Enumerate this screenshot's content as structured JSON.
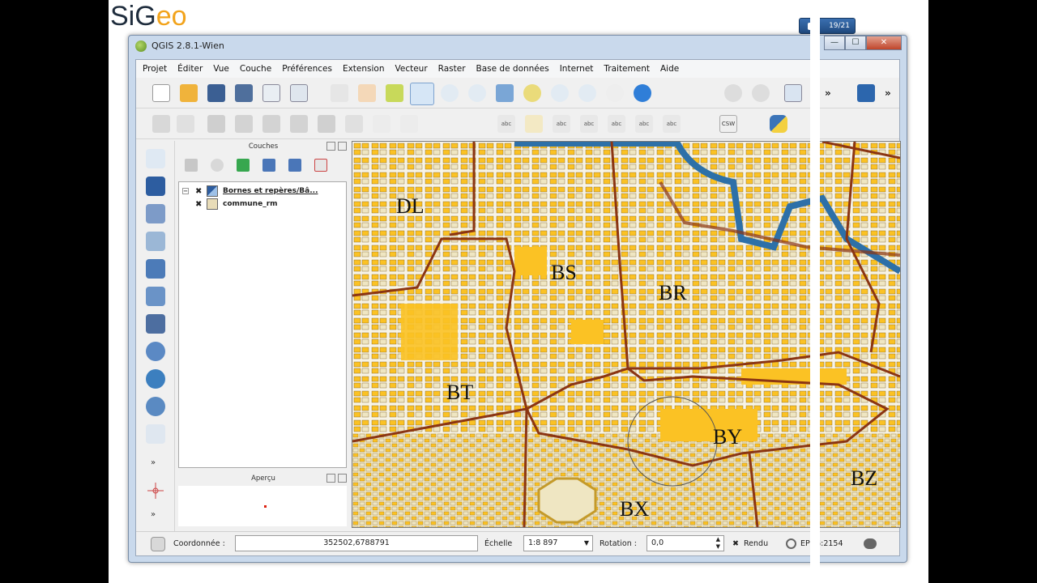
{
  "branding": {
    "logo_main": "SiG",
    "logo_accent": "eo"
  },
  "taskbar_badge": {
    "label": "19/21"
  },
  "window": {
    "title": "QGIS 2.8.1-Wien",
    "controls": {
      "minimize": "—",
      "maximize": "☐",
      "close": "✕"
    }
  },
  "menu": [
    "Projet",
    "Éditer",
    "Vue",
    "Couche",
    "Préférences",
    "Extension",
    "Vecteur",
    "Raster",
    "Base de données",
    "Internet",
    "Traitement",
    "Aide"
  ],
  "toolbar_overflow": "»",
  "layers_panel": {
    "title": "Couches",
    "layers": [
      {
        "name": "Bornes et repères/Bâ...",
        "checked": "✖",
        "expander": "−"
      },
      {
        "name": "commune_rm",
        "checked": "✖"
      }
    ]
  },
  "overview_panel": {
    "title": "Aperçu"
  },
  "map": {
    "labels": [
      "DL",
      "BS",
      "BR",
      "BT",
      "BY",
      "BZ",
      "BX"
    ],
    "colors": {
      "background": "#efe6c2",
      "buildings": "#fbc224",
      "boundaries": "#8b3513",
      "water": "#2d70a8",
      "streets": "#f8f4e6"
    }
  },
  "statusbar": {
    "coord_label": "Coordonnée :",
    "coord_value": "352502,6788791",
    "scale_label": "Échelle",
    "scale_value": "1:8 897",
    "rotation_label": "Rotation :",
    "rotation_value": "0,0",
    "render_check": "✖",
    "render_label": "Rendu",
    "crs": "EPSG:2154"
  },
  "toolbar_labels": {
    "csw": "CSW",
    "abc": "abc"
  }
}
